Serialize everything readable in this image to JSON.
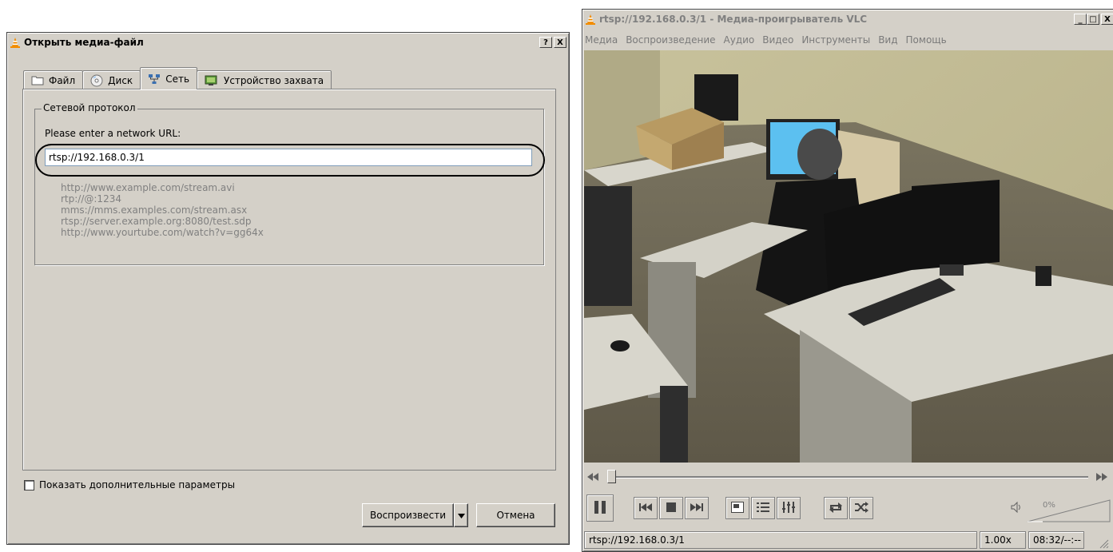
{
  "open_dialog": {
    "title": "Открыть медиа-файл",
    "help_button": "?",
    "close_button": "X",
    "tabs": [
      {
        "label": "Файл",
        "icon": "folder-icon"
      },
      {
        "label": "Диск",
        "icon": "disc-icon"
      },
      {
        "label": "Сеть",
        "icon": "network-icon",
        "selected": true
      },
      {
        "label": "Устройство захвата",
        "icon": "capture-device-icon"
      }
    ],
    "group_title": "Сетевой протокол",
    "url_label": "Please enter a network URL:",
    "url_value": "rtsp://192.168.0.3/1",
    "examples": [
      "http://www.example.com/stream.avi",
      "rtp://@:1234",
      "mms://mms.examples.com/stream.asx",
      "rtsp://server.example.org:8080/test.sdp",
      "http://www.yourtube.com/watch?v=gg64x"
    ],
    "show_more_options": "Показать дополнительные параметры",
    "play_button": "Воспроизвести",
    "cancel_button": "Отмена"
  },
  "vlc": {
    "title": "rtsp://192.168.0.3/1 - Медиа-проигрыватель VLC",
    "window_buttons": [
      "_",
      "□",
      "X"
    ],
    "menu": [
      "Медиа",
      "Воспроизведение",
      "Аудио",
      "Видео",
      "Инструменты",
      "Вид",
      "Помощь"
    ],
    "volume_percent": "0%",
    "status": {
      "media": "rtsp://192.168.0.3/1",
      "speed": "1.00x",
      "time": "08:32/--:--"
    }
  },
  "colors": {
    "window_face": "#d4d0c8",
    "shadow": "#808080",
    "highlight": "#ffffff",
    "vlc_orange": "#f28c00",
    "hint_gray": "#808080"
  }
}
